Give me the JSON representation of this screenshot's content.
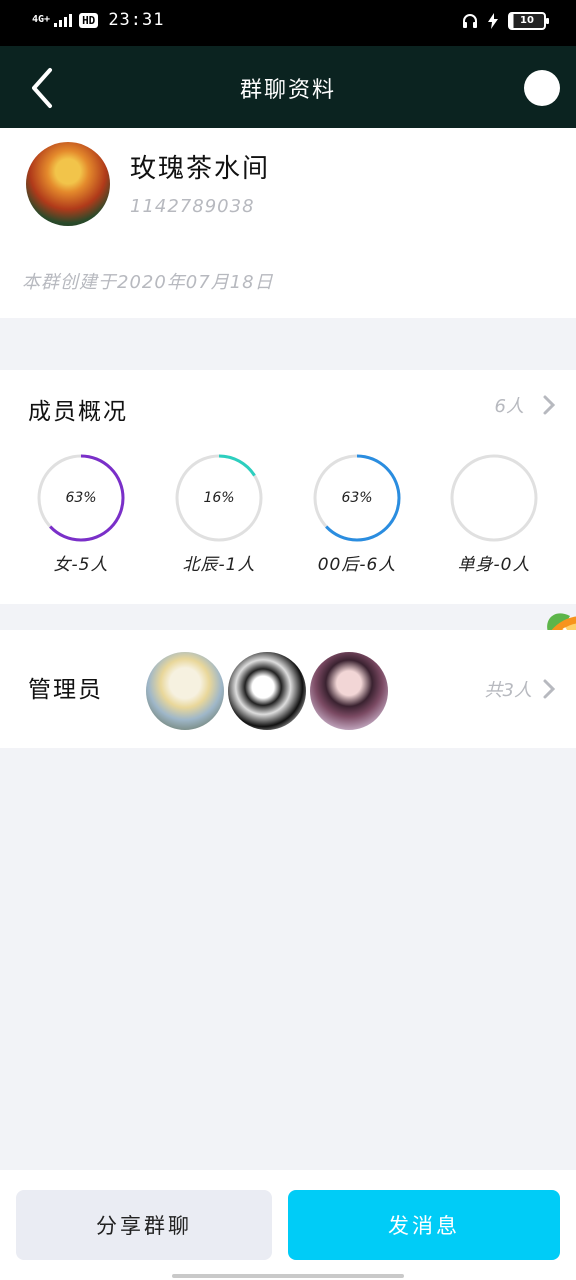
{
  "status_bar": {
    "network": "4G+",
    "hd_badge": "HD",
    "time": "23:31",
    "battery": "10"
  },
  "header": {
    "title": "群聊资料"
  },
  "group": {
    "name": "玫瑰茶水间",
    "id": "1142789038",
    "created": "本群创建于2020年07月18日"
  },
  "members": {
    "title": "成员概况",
    "count": "6人",
    "stats": [
      {
        "percent_text": "63%",
        "label": "女-5人",
        "value": 0.63,
        "color": "#7a2fc9"
      },
      {
        "percent_text": "16%",
        "label": "北辰-1人",
        "value": 0.16,
        "color": "#2ccfbf"
      },
      {
        "percent_text": "63%",
        "label": "00后-6人",
        "value": 0.63,
        "color": "#2a8de0"
      },
      {
        "percent_text": "",
        "label": "单身-0人",
        "value": 0,
        "color": "#2a8de0"
      }
    ]
  },
  "admins": {
    "title": "管理员",
    "count": "共3人"
  },
  "actions": {
    "share": "分享群聊",
    "send": "发消息"
  },
  "colors": {
    "header_bg": "#0b2320",
    "send_button": "#00ccf7",
    "ring_track": "#e0e0e0"
  }
}
